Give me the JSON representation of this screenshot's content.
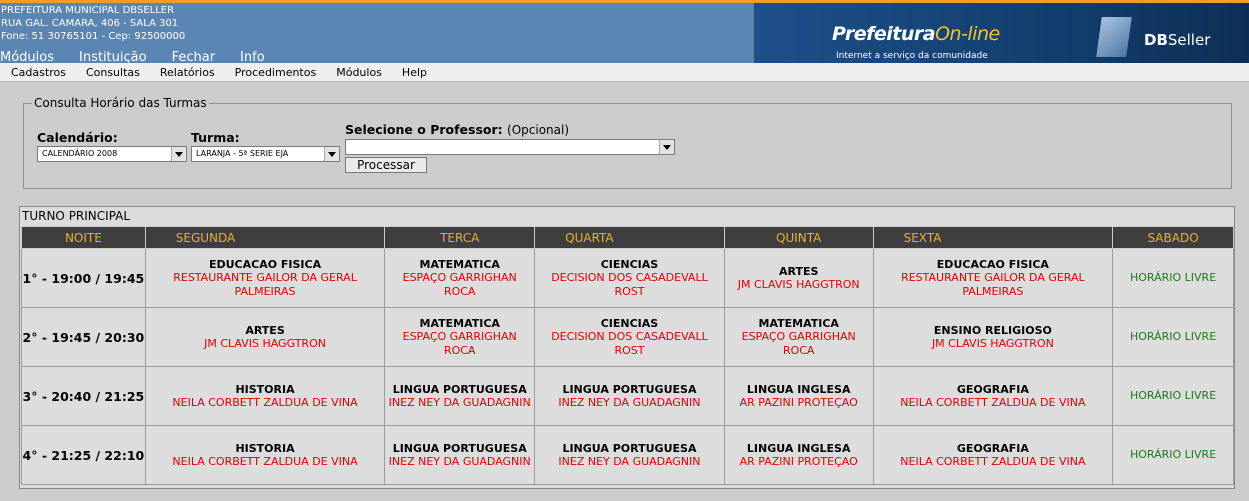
{
  "org": {
    "name": "PREFEITURA MUNICIPAL DBSELLER",
    "address": "RUA GAL. CAMARA, 406 - SALA 301",
    "contact": "Fone: 51 30765101  -  Cep: 92500000"
  },
  "main_menu": [
    "Módulos",
    "Instituição",
    "Fechar",
    "Info"
  ],
  "banner": {
    "brand": "Prefeitura",
    "brand_highlight": "On-line",
    "tagline": "Internet a serviço da comunidade",
    "vendor_bold": "DB",
    "vendor": "Seller"
  },
  "sub_menu": [
    "Cadastros",
    "Consultas",
    "Relatórios",
    "Procedimentos",
    "Módulos",
    "Help"
  ],
  "form": {
    "legend": "Consulta Horário das Turmas",
    "calendario_label": "Calendário:",
    "calendario_value": "CALENDÁRIO 2008",
    "turma_label": "Turma:",
    "turma_value": "LARANJA - 5ª SERIE EJA",
    "professor_label": "Selecione o Professor:",
    "professor_optional": "(Opcional)",
    "professor_value": "",
    "process_button": "Processar"
  },
  "schedule": {
    "shift_title": "TURNO PRINCIPAL",
    "headers": [
      "NOITE",
      "SEGUNDA",
      "TERCA",
      "QUARTA",
      "QUINTA",
      "SEXTA",
      "SABADO"
    ],
    "rows": [
      {
        "time": "1° - 19:00 / 19:45",
        "cells": [
          {
            "subject": "EDUCACAO FISICA",
            "teacher": "RESTAURANTE GAILOR DA GERAL PALMEIRAS"
          },
          {
            "subject": "MATEMATICA",
            "teacher": "ESPAÇO GARRIGHAN ROCA"
          },
          {
            "subject": "CIENCIAS",
            "teacher": "DECISION DOS CASADEVALL ROST"
          },
          {
            "subject": "ARTES",
            "teacher": "JM CLAVIS HAGGTRON"
          },
          {
            "subject": "EDUCACAO FISICA",
            "teacher": "RESTAURANTE GAILOR DA GERAL PALMEIRAS"
          },
          {
            "free": "HORÁRIO LIVRE"
          }
        ]
      },
      {
        "time": "2° - 19:45 / 20:30",
        "cells": [
          {
            "subject": "ARTES",
            "teacher": "JM CLAVIS HAGGTRON"
          },
          {
            "subject": "MATEMATICA",
            "teacher": "ESPAÇO GARRIGHAN ROCA"
          },
          {
            "subject": "CIENCIAS",
            "teacher": "DECISION DOS CASADEVALL ROST"
          },
          {
            "subject": "MATEMATICA",
            "teacher": "ESPAÇO GARRIGHAN ROCA"
          },
          {
            "subject": "ENSINO RELIGIOSO",
            "teacher": "JM CLAVIS HAGGTRON"
          },
          {
            "free": "HORÁRIO LIVRE"
          }
        ]
      },
      {
        "time": "3° - 20:40 / 21:25",
        "cells": [
          {
            "subject": "HISTORIA",
            "teacher": "NEILA CORBETT ZALDUA DE VINA"
          },
          {
            "subject": "LINGUA PORTUGUESA",
            "teacher": "INEZ NEY DA GUADAGNIN"
          },
          {
            "subject": "LINGUA PORTUGUESA",
            "teacher": "INEZ NEY DA GUADAGNIN"
          },
          {
            "subject": "LINGUA INGLESA",
            "teacher": "AR PAZINI PROTEÇAO"
          },
          {
            "subject": "GEOGRAFIA",
            "teacher": "NEILA CORBETT ZALDUA DE VINA"
          },
          {
            "free": "HORÁRIO LIVRE"
          }
        ]
      },
      {
        "time": "4° - 21:25 / 22:10",
        "cells": [
          {
            "subject": "HISTORIA",
            "teacher": "NEILA CORBETT ZALDUA DE VINA"
          },
          {
            "subject": "LINGUA PORTUGUESA",
            "teacher": "INEZ NEY DA GUADAGNIN"
          },
          {
            "subject": "LINGUA PORTUGUESA",
            "teacher": "INEZ NEY DA GUADAGNIN"
          },
          {
            "subject": "LINGUA INGLESA",
            "teacher": "AR PAZINI PROTEÇAO"
          },
          {
            "subject": "GEOGRAFIA",
            "teacher": "NEILA CORBETT ZALDUA DE VINA"
          },
          {
            "free": "HORÁRIO LIVRE"
          }
        ]
      }
    ]
  }
}
